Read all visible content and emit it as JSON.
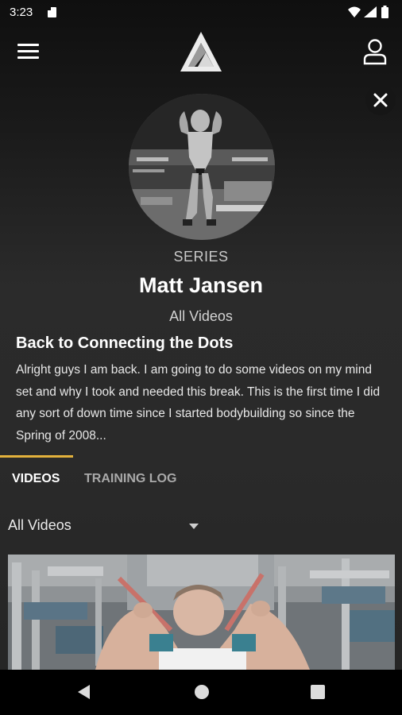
{
  "status_bar": {
    "time": "3:23"
  },
  "header": {
    "menu_icon": "hamburger-menu-icon",
    "logo": "triangle-logo",
    "profile_icon": "user-profile-icon",
    "close_icon": "close-icon"
  },
  "profile": {
    "type_label": "SERIES",
    "name": "Matt Jansen",
    "link_label": "All Videos"
  },
  "description": {
    "title": "Back to Connecting the Dots",
    "body": "Alright guys I am back. I am going to do some videos on my mind set and why I took and needed this break. This is the first time I did any sort of down time since I started bodybuilding so since the Spring of 2008..."
  },
  "tabs": [
    {
      "label": "VIDEOS",
      "active": true
    },
    {
      "label": "TRAINING LOG",
      "active": false
    }
  ],
  "filter": {
    "selected": "All Videos"
  },
  "colors": {
    "accent": "#e2b13c",
    "background": "#2a2a2a"
  },
  "nav_bar": {
    "back_icon": "back-triangle-icon",
    "home_icon": "home-circle-icon",
    "recents_icon": "recents-square-icon"
  }
}
